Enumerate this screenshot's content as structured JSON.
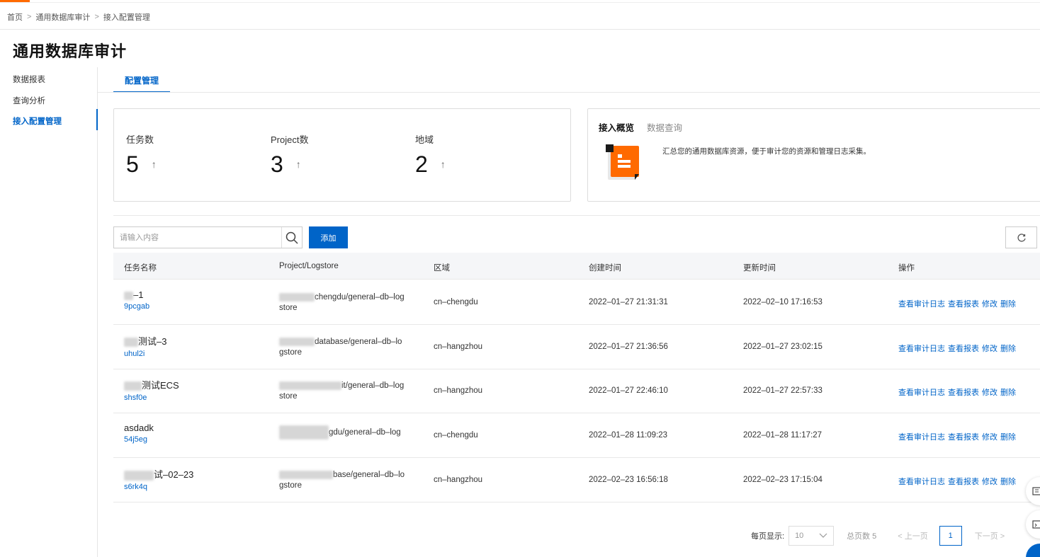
{
  "breadcrumb": {
    "home": "首页",
    "parent": "通用数据库审计",
    "current": "接入配置管理"
  },
  "page_title": "通用数据库审计",
  "sidebar": {
    "items": [
      {
        "label": "数据报表"
      },
      {
        "label": "查询分析"
      },
      {
        "label": "接入配置管理"
      }
    ]
  },
  "tab": {
    "label": "配置管理"
  },
  "stats": [
    {
      "label": "任务数",
      "value": "5",
      "arrow": "↑"
    },
    {
      "label": "Project数",
      "value": "3",
      "arrow": "↑"
    },
    {
      "label": "地域",
      "value": "2",
      "arrow": "↑"
    }
  ],
  "overview": {
    "tabs": [
      "接入概览",
      "数据查询"
    ],
    "description": "汇总您的通用数据库资源，便于审计您的资源和管理日志采集。"
  },
  "toolbar": {
    "search_placeholder": "请输入内容",
    "add_label": "添加"
  },
  "table": {
    "headers": [
      "任务名称",
      "Project/Logstore",
      "区域",
      "创建时间",
      "更新时间",
      "操作"
    ],
    "operations": [
      "查看审计日志",
      "查看报表",
      "修改",
      "删除"
    ],
    "rows": [
      {
        "name": "–1",
        "id": "9pcgab",
        "project": "chengdu/general–db–log",
        "project2": "store",
        "region": "cn–chengdu",
        "created": "2022–01–27 21:31:31",
        "updated": "2022–02–10 17:16:53"
      },
      {
        "name": "测试–3",
        "id": "uhul2i",
        "project": "database/general–db–lo",
        "project2": "gstore",
        "region": "cn–hangzhou",
        "created": "2022–01–27 21:36:56",
        "updated": "2022–01–27 23:02:15"
      },
      {
        "name": "测试ECS",
        "id": "shsf0e",
        "project": "it/general–db–log",
        "project2": "store",
        "region": "cn–hangzhou",
        "created": "2022–01–27 22:46:10",
        "updated": "2022–01–27 22:57:33"
      },
      {
        "name": "asdadk",
        "id": "54j5eg",
        "project": "gdu/general–db–log",
        "project2": "",
        "region": "cn–chengdu",
        "created": "2022–01–28 11:09:23",
        "updated": "2022–01–28 11:17:27"
      },
      {
        "name": "试–02–23",
        "id": "s6rk4q",
        "project": "base/general–db–lo",
        "project2": "gstore",
        "region": "cn–hangzhou",
        "created": "2022–02–23 16:56:18",
        "updated": "2022–02–23 17:15:04"
      }
    ]
  },
  "pagination": {
    "page_size_label": "每页显示:",
    "page_size": "10",
    "total_label": "总页数 5",
    "prev_label": "上一页",
    "current_page": "1",
    "next_label": "下一页"
  },
  "colors": {
    "accent": "#0064c8",
    "brand": "#ff6a00"
  }
}
